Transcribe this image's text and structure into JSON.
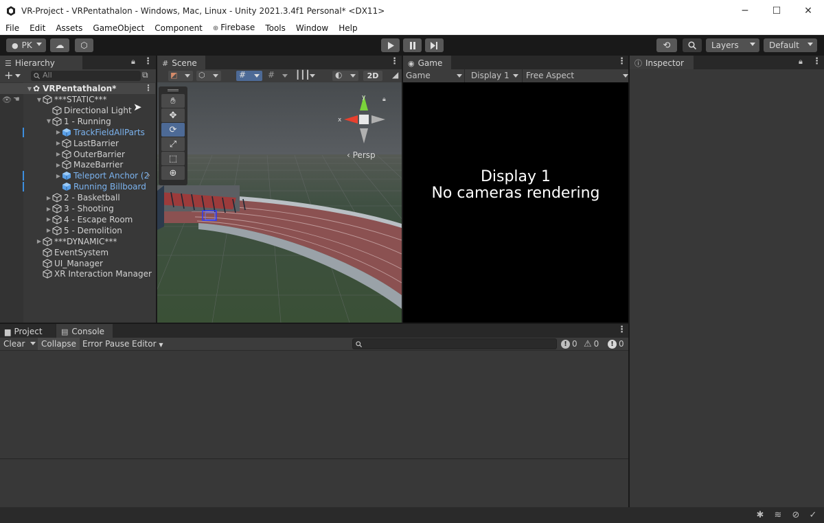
{
  "window": {
    "title": "VR-Project - VRPentathalon - Windows, Mac, Linux - Unity 2021.3.4f1 Personal* <DX11>",
    "minimize": "─",
    "maximize": "☐",
    "close": "✕"
  },
  "menu": [
    "File",
    "Edit",
    "Assets",
    "GameObject",
    "Component",
    "Firebase",
    "Tools",
    "Window",
    "Help"
  ],
  "toolbar": {
    "account": "PK",
    "layers": "Layers",
    "layout": "Default"
  },
  "hierarchy": {
    "tab": "Hierarchy",
    "search_placeholder": "All",
    "scene": "VRPentathalon*",
    "rows": [
      {
        "label": "***STATIC***",
        "indent": 1,
        "fold": "down",
        "prefab": false
      },
      {
        "label": "Directional Light",
        "indent": 2,
        "fold": "none",
        "prefab": false
      },
      {
        "label": "1 - Running",
        "indent": 2,
        "fold": "down",
        "prefab": false
      },
      {
        "label": "TrackFieldAllParts",
        "indent": 3,
        "fold": "right",
        "prefab": true
      },
      {
        "label": "LastBarrier",
        "indent": 3,
        "fold": "right",
        "prefab": false
      },
      {
        "label": "OuterBarrier",
        "indent": 3,
        "fold": "right",
        "prefab": false
      },
      {
        "label": "MazeBarrier",
        "indent": 3,
        "fold": "right",
        "prefab": false
      },
      {
        "label": "Teleport Anchor (2",
        "indent": 3,
        "fold": "right",
        "prefab": true
      },
      {
        "label": "Running Billboard",
        "indent": 3,
        "fold": "none",
        "prefab": true
      },
      {
        "label": "2 - Basketball",
        "indent": 2,
        "fold": "right",
        "prefab": false
      },
      {
        "label": "3 - Shooting",
        "indent": 2,
        "fold": "right",
        "prefab": false
      },
      {
        "label": "4 - Escape Room",
        "indent": 2,
        "fold": "right",
        "prefab": false
      },
      {
        "label": "5 - Demolition",
        "indent": 2,
        "fold": "right",
        "prefab": false
      },
      {
        "label": "***DYNAMIC***",
        "indent": 1,
        "fold": "right",
        "prefab": false
      },
      {
        "label": "EventSystem",
        "indent": 1,
        "fold": "none",
        "prefab": false
      },
      {
        "label": "UI_Manager",
        "indent": 1,
        "fold": "none",
        "prefab": false
      },
      {
        "label": "XR Interaction Manager",
        "indent": 1,
        "fold": "none",
        "prefab": false
      }
    ]
  },
  "scene": {
    "tab": "Scene",
    "mode_2d": "2D",
    "projection": "Persp",
    "gizmo_x": "x",
    "gizmo_y": "y"
  },
  "game": {
    "tab": "Game",
    "view_mode": "Game",
    "display": "Display 1",
    "aspect": "Free Aspect",
    "message_line1": "Display 1",
    "message_line2": "No cameras rendering"
  },
  "inspector": {
    "tab": "Inspector"
  },
  "bottom": {
    "project_tab": "Project",
    "console_tab": "Console",
    "clear": "Clear",
    "collapse": "Collapse",
    "error_pause": "Error Pause",
    "editor": "Editor",
    "log_count": "0",
    "warning_count": "0",
    "error_count": "0"
  }
}
